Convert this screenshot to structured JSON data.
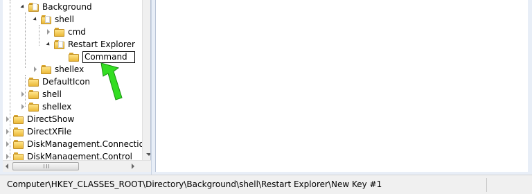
{
  "tree": {
    "items": [
      {
        "label": "Background",
        "state": "expanded"
      },
      {
        "label": "shell",
        "state": "expanded"
      },
      {
        "label": "cmd",
        "state": "collapsed"
      },
      {
        "label": "Restart Explorer",
        "state": "expanded"
      },
      {
        "label": "Command",
        "state": "editing"
      },
      {
        "label": "shellex",
        "state": "collapsed"
      },
      {
        "label": "DefaultIcon",
        "state": "leaf"
      },
      {
        "label": "shell",
        "state": "collapsed"
      },
      {
        "label": "shellex",
        "state": "collapsed"
      },
      {
        "label": "DirectShow",
        "state": "collapsed"
      },
      {
        "label": "DirectXFile",
        "state": "collapsed"
      },
      {
        "label": "DiskManagement.Connection",
        "state": "collapsed"
      },
      {
        "label": "DiskManagement.Control",
        "state": "collapsed"
      }
    ]
  },
  "status": {
    "path": "Computer\\HKEY_CLASSES_ROOT\\Directory\\Background\\shell\\Restart Explorer\\New Key #1"
  },
  "colors": {
    "annotation_arrow": "#33dd22",
    "folder": "#eab838"
  }
}
